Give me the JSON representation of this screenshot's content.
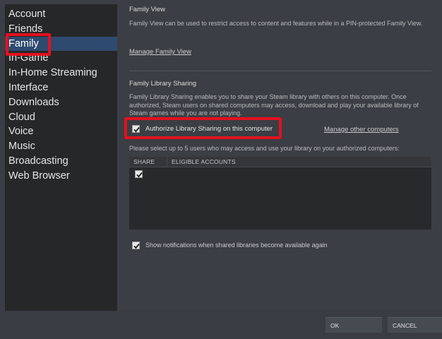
{
  "sidebar": {
    "items": [
      {
        "label": "Account"
      },
      {
        "label": "Friends"
      },
      {
        "label": "Family"
      },
      {
        "label": "In-Game"
      },
      {
        "label": "In-Home Streaming"
      },
      {
        "label": "Interface"
      },
      {
        "label": "Downloads"
      },
      {
        "label": "Cloud"
      },
      {
        "label": "Voice"
      },
      {
        "label": "Music"
      },
      {
        "label": "Broadcasting"
      },
      {
        "label": "Web Browser"
      }
    ],
    "active": "Family"
  },
  "family_view": {
    "title": "Family View",
    "description": "Family View can be used to restrict access to content and features while in a PIN-protected Family View.",
    "manage_link": "Manage Family View"
  },
  "library_sharing": {
    "title": "Family Library Sharing",
    "description": "Family Library Sharing enables you to share your Steam library with others on this computer. Once authorized, Steam users on shared computers may access, download and play your available library of Steam games while you are not playing.",
    "authorize_label": "Authorize Library Sharing on this computer",
    "authorize_checked": true,
    "manage_other_link": "Manage other computers",
    "select_prompt": "Please select up to 5 users who may access and use your library on your authorized computers:",
    "table": {
      "columns": [
        "SHARE",
        "ELIGIBLE ACCOUNTS"
      ],
      "rows": [
        {
          "share": true,
          "account": ""
        }
      ]
    },
    "notify_label": "Show notifications when shared libraries become available again",
    "notify_checked": true
  },
  "buttons": {
    "ok": "OK",
    "cancel": "CANCEL"
  },
  "colors": {
    "highlight": "#e4101e",
    "active_item": "#2f4a6f"
  }
}
